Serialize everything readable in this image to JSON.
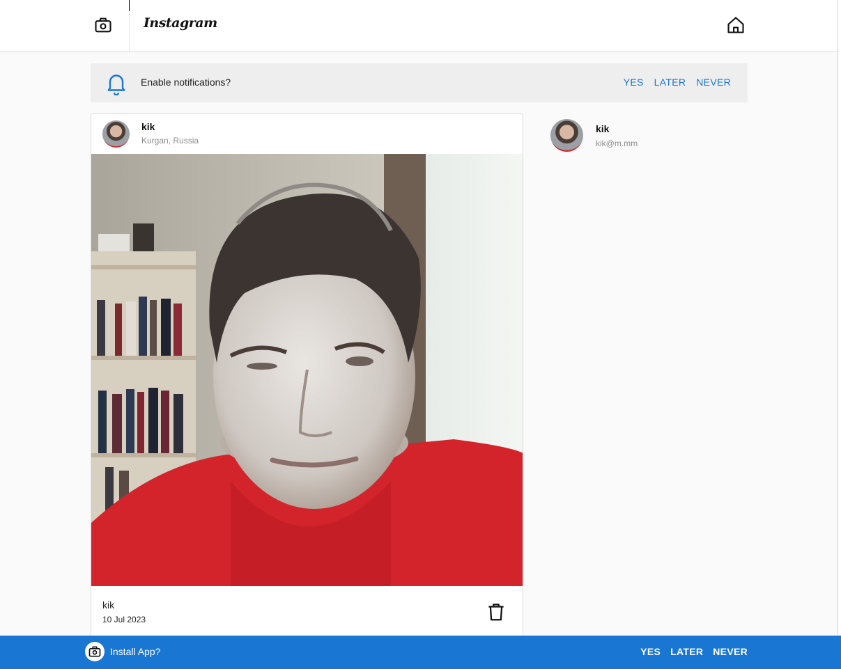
{
  "header": {
    "logo_text": "Instagram",
    "camera_icon": "camera-icon",
    "home_icon": "home-icon"
  },
  "notification_banner": {
    "icon": "bell-icon",
    "message": "Enable notifications?",
    "yes_label": "YES",
    "later_label": "LATER",
    "never_label": "NEVER"
  },
  "post": {
    "author": "kik",
    "location": "Kurgan, Russia",
    "image_alt": "Selfie photo of a man in a red shirt in front of bookshelves",
    "caption": "kik",
    "date": "10 Jul 2023",
    "delete_icon": "trash-icon"
  },
  "profile": {
    "name": "kik",
    "email": "kik@m.mm"
  },
  "install_banner": {
    "icon": "camera-icon",
    "message": "Install App?",
    "yes_label": "YES",
    "later_label": "LATER",
    "never_label": "NEVER"
  },
  "colors": {
    "accent": "#1976d2",
    "banner_bg": "#eeeeee",
    "page_bg": "#fafafa"
  }
}
